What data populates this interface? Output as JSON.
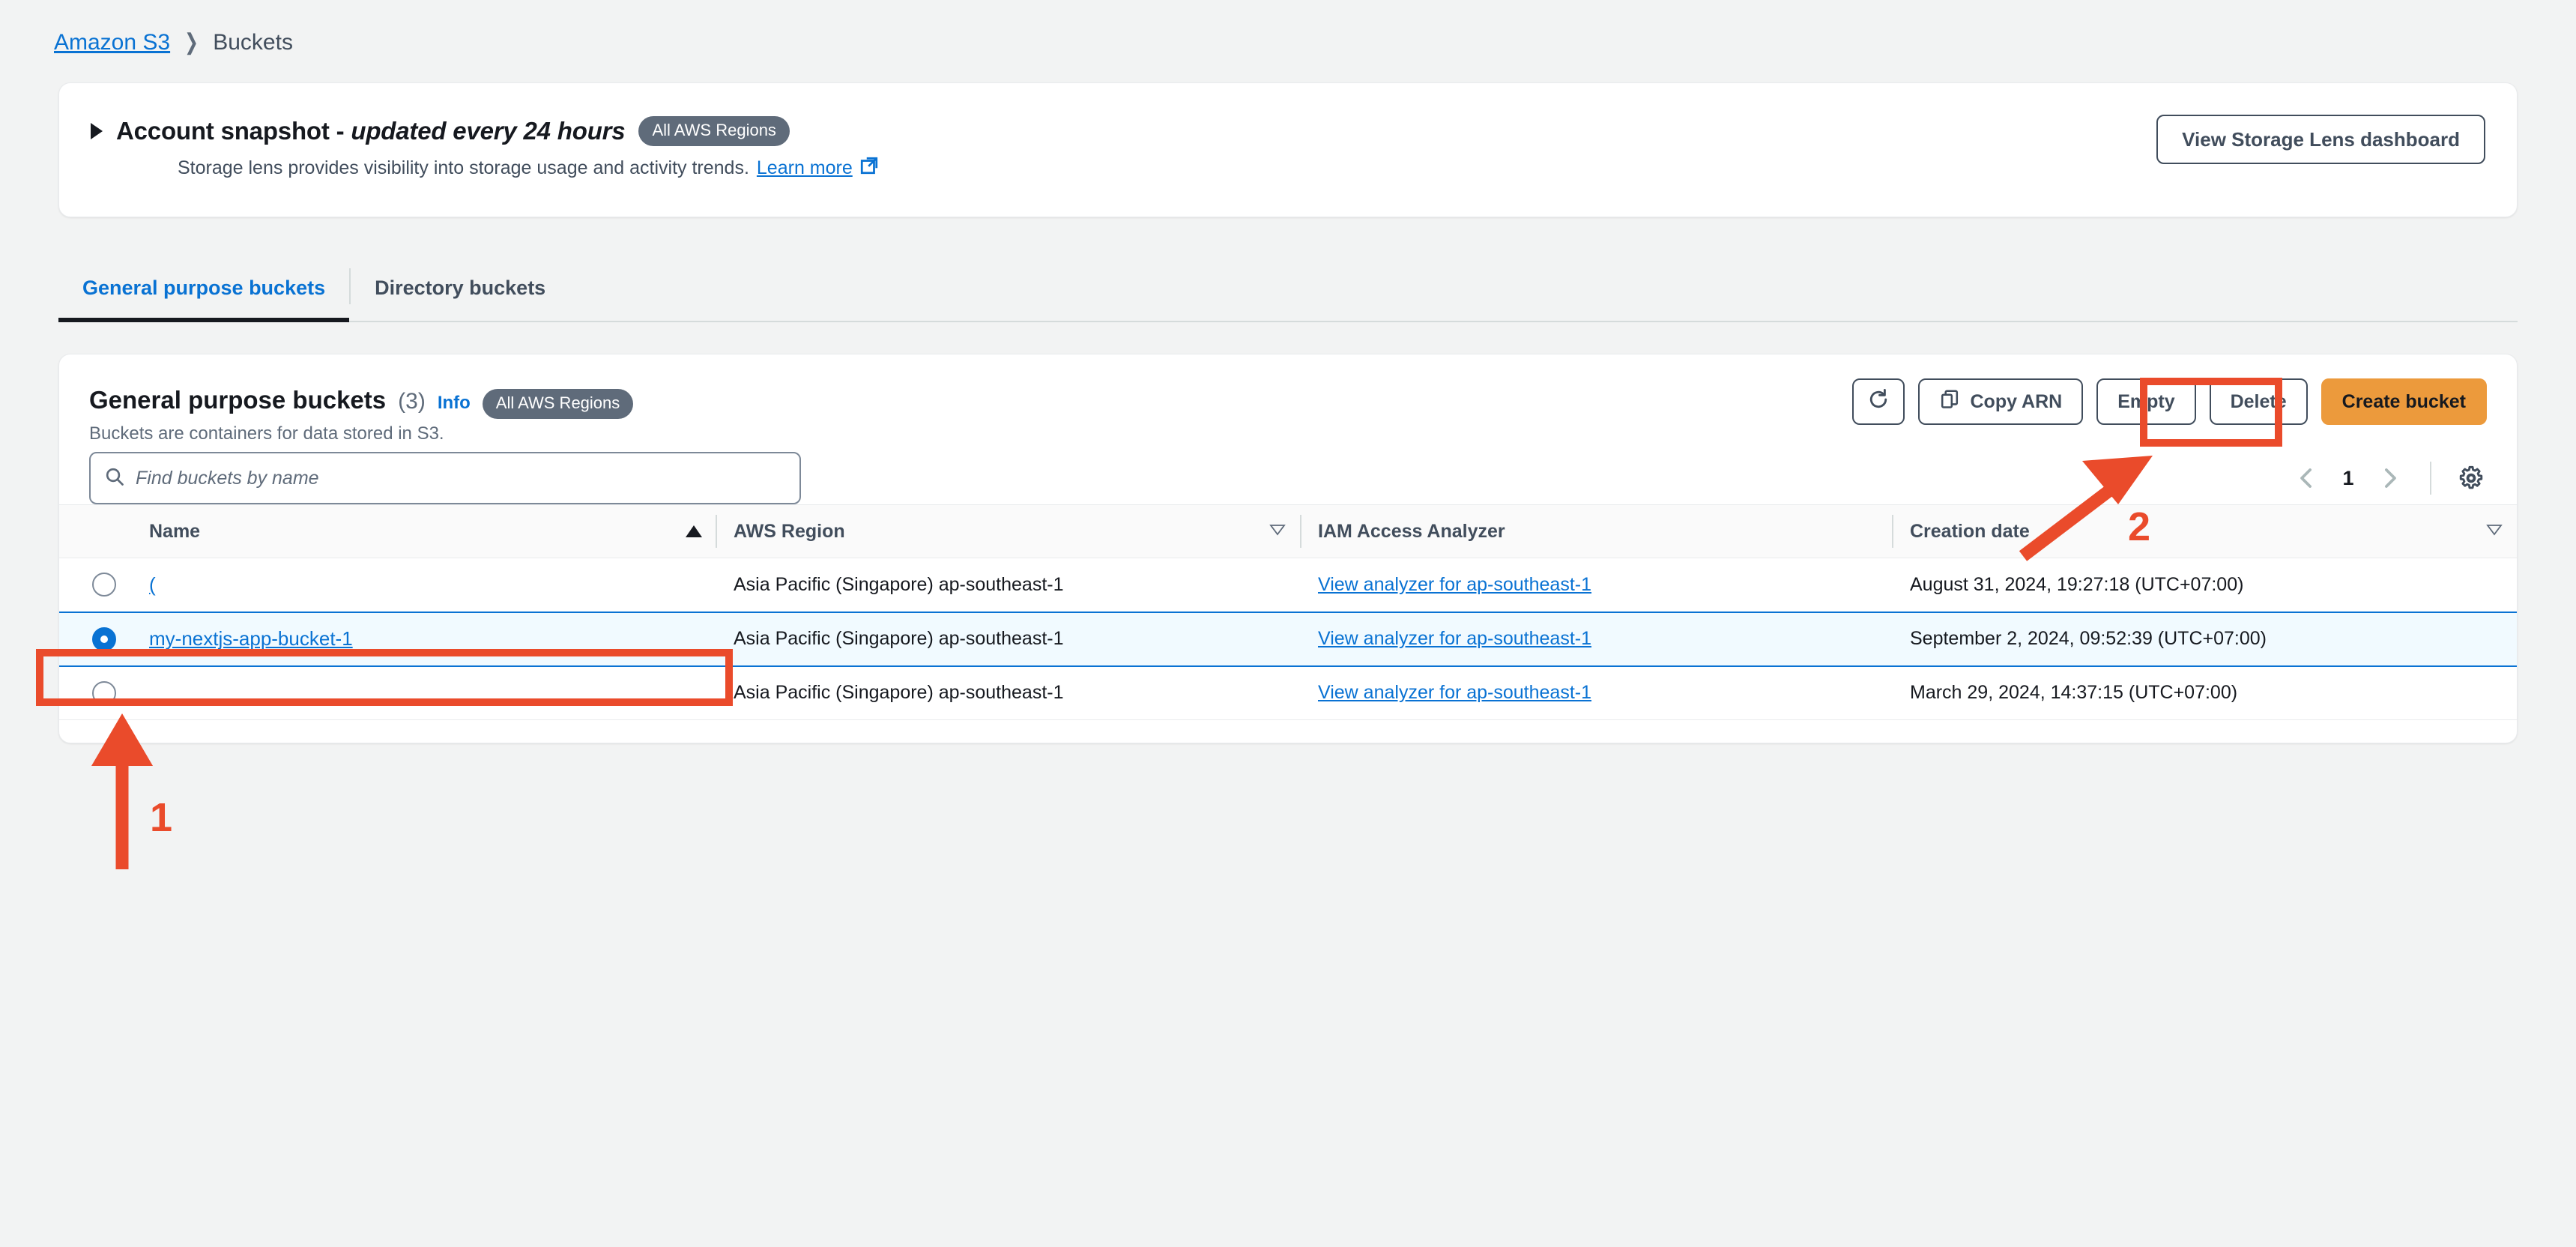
{
  "breadcrumb": {
    "root": "Amazon S3",
    "current": "Buckets"
  },
  "snapshot": {
    "title_bold": "Account snapshot",
    "title_dash": " - ",
    "title_italic": "updated every 24 hours",
    "badge": "All AWS Regions",
    "description": "Storage lens provides visibility into storage usage and activity trends.",
    "learn_more": "Learn more",
    "dashboard_button": "View Storage Lens dashboard",
    "expand_icon": "caret-right-icon",
    "external_icon": "external-link-icon"
  },
  "tabs": [
    {
      "label": "General purpose buckets",
      "active": true
    },
    {
      "label": "Directory buckets",
      "active": false
    }
  ],
  "panel": {
    "title": "General purpose buckets",
    "count": "(3)",
    "info": "Info",
    "badge": "All AWS Regions",
    "subtitle": "Buckets are containers for data stored in S3."
  },
  "actions": {
    "refresh_icon": "refresh-icon",
    "copy_arn": "Copy ARN",
    "copy_icon": "copy-icon",
    "empty": "Empty",
    "delete": "Delete",
    "create_bucket": "Create bucket"
  },
  "search": {
    "placeholder": "Find buckets by name",
    "icon": "search-icon"
  },
  "pagination": {
    "prev_icon": "chevron-left-icon",
    "page": "1",
    "next_icon": "chevron-right-icon",
    "settings_icon": "gear-icon"
  },
  "table": {
    "columns": [
      {
        "label": "Name",
        "sort": "asc"
      },
      {
        "label": "AWS Region",
        "sort": "none"
      },
      {
        "label": "IAM Access Analyzer",
        "sort": "none"
      },
      {
        "label": "Creation date",
        "sort": "none"
      }
    ],
    "rows": [
      {
        "selected": false,
        "name": "(",
        "region": "Asia Pacific (Singapore) ap-southeast-1",
        "analyzer": "View analyzer for ap-southeast-1",
        "created": "August 31, 2024, 19:27:18 (UTC+07:00)"
      },
      {
        "selected": true,
        "name": "my-nextjs-app-bucket-1",
        "region": "Asia Pacific (Singapore) ap-southeast-1",
        "analyzer": "View analyzer for ap-southeast-1",
        "created": "September 2, 2024, 09:52:39 (UTC+07:00)"
      },
      {
        "selected": false,
        "name": "",
        "region": "Asia Pacific (Singapore) ap-southeast-1",
        "analyzer": "View analyzer for ap-southeast-1",
        "created": "March 29, 2024, 14:37:15 (UTC+07:00)"
      }
    ]
  },
  "annotations": {
    "step_one": "1",
    "step_two": "2",
    "color": "#ea4b2b"
  }
}
